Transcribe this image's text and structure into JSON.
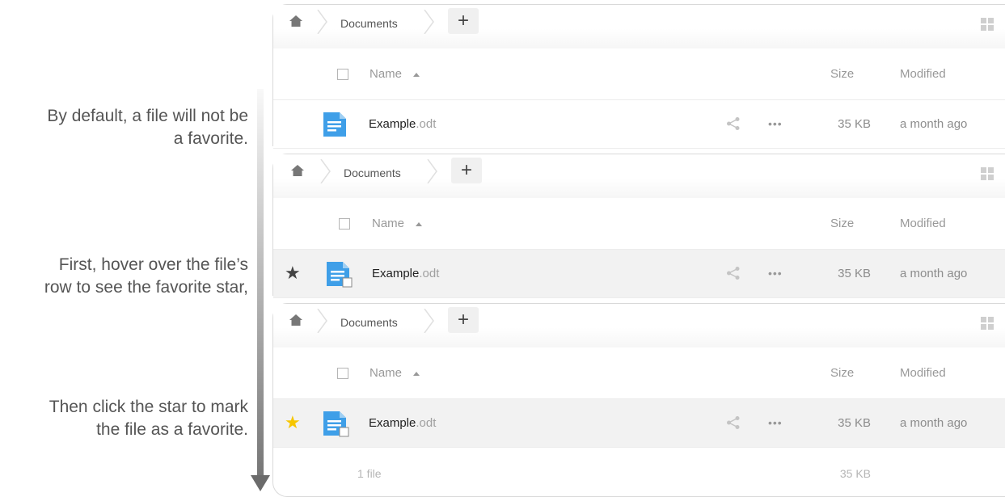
{
  "annotations": [
    {
      "line1": "By default, a file will not be",
      "line2": "a favorite."
    },
    {
      "line1": "First, hover over the file’s",
      "line2": "row to see the favorite star,"
    },
    {
      "line1": "Then click the star to mark",
      "line2": "the file as a favorite."
    }
  ],
  "panels": [
    {
      "breadcrumb": "Documents",
      "add_label": "+",
      "columns": {
        "name": "Name",
        "size": "Size",
        "modified": "Modified"
      },
      "file": {
        "basename": "Example",
        "ext": ".odt",
        "size": "35 KB",
        "modified": "a month ago",
        "star": "none"
      }
    },
    {
      "breadcrumb": "Documents",
      "add_label": "+",
      "columns": {
        "name": "Name",
        "size": "Size",
        "modified": "Modified"
      },
      "file": {
        "basename": "Example",
        "ext": ".odt",
        "size": "35 KB",
        "modified": "a month ago",
        "star": "★"
      }
    },
    {
      "breadcrumb": "Documents",
      "add_label": "+",
      "columns": {
        "name": "Name",
        "size": "Size",
        "modified": "Modified"
      },
      "file": {
        "basename": "Example",
        "ext": ".odt",
        "size": "35 KB",
        "modified": "a month ago",
        "star": "★"
      },
      "footer": {
        "count": "1 file",
        "size": "35 KB"
      }
    }
  ],
  "icons": {
    "home": "home-icon",
    "document": "document-icon",
    "share": "share-icon",
    "more": "more-icon",
    "grid": "grid-view-icon",
    "star": "star-icon"
  },
  "colors": {
    "star_hover": "#444444",
    "star_favorite": "#f7c600",
    "file_icon": "#3f9fe8",
    "text_muted": "#999999"
  },
  "more_glyph": "•••"
}
